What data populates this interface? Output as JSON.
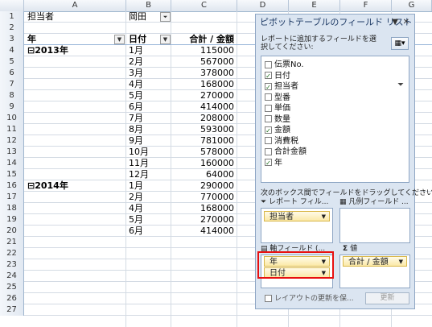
{
  "columns": [
    "A",
    "B",
    "C",
    "D",
    "E",
    "F",
    "G"
  ],
  "rows": [
    {
      "n": "1",
      "a": "担当者",
      "b": "岡田",
      "c": "",
      "bfilter": true
    },
    {
      "n": "2",
      "a": "",
      "b": "",
      "c": ""
    },
    {
      "n": "3",
      "a": "年",
      "b": "日付",
      "c": "合計 / 金額",
      "header": true
    },
    {
      "n": "4",
      "a": "⊟2013年",
      "b": "1月",
      "c": "115000",
      "bold": true
    },
    {
      "n": "5",
      "a": "",
      "b": "2月",
      "c": "567000"
    },
    {
      "n": "6",
      "a": "",
      "b": "3月",
      "c": "378000"
    },
    {
      "n": "7",
      "a": "",
      "b": "4月",
      "c": "168000"
    },
    {
      "n": "8",
      "a": "",
      "b": "5月",
      "c": "270000"
    },
    {
      "n": "9",
      "a": "",
      "b": "6月",
      "c": "414000"
    },
    {
      "n": "10",
      "a": "",
      "b": "7月",
      "c": "208000"
    },
    {
      "n": "11",
      "a": "",
      "b": "8月",
      "c": "593000"
    },
    {
      "n": "12",
      "a": "",
      "b": "9月",
      "c": "781000"
    },
    {
      "n": "13",
      "a": "",
      "b": "10月",
      "c": "578000"
    },
    {
      "n": "14",
      "a": "",
      "b": "11月",
      "c": "160000"
    },
    {
      "n": "15",
      "a": "",
      "b": "12月",
      "c": "64000"
    },
    {
      "n": "16",
      "a": "⊟2014年",
      "b": "1月",
      "c": "290000",
      "bold": true
    },
    {
      "n": "17",
      "a": "",
      "b": "2月",
      "c": "770000"
    },
    {
      "n": "18",
      "a": "",
      "b": "4月",
      "c": "168000"
    },
    {
      "n": "19",
      "a": "",
      "b": "5月",
      "c": "270000"
    },
    {
      "n": "20",
      "a": "",
      "b": "6月",
      "c": "414000"
    },
    {
      "n": "21",
      "a": "",
      "b": "",
      "c": ""
    },
    {
      "n": "22",
      "a": "",
      "b": "",
      "c": ""
    },
    {
      "n": "23",
      "a": "",
      "b": "",
      "c": ""
    },
    {
      "n": "24",
      "a": "",
      "b": "",
      "c": ""
    },
    {
      "n": "25",
      "a": "",
      "b": "",
      "c": ""
    },
    {
      "n": "26",
      "a": "",
      "b": "",
      "c": ""
    },
    {
      "n": "27",
      "a": "",
      "b": "",
      "c": ""
    }
  ],
  "panel": {
    "title": "ピボットテーブルのフィールド リスト",
    "instruction": "レポートに追加するフィールドを選択してください:",
    "fields": [
      {
        "label": "伝票No.",
        "checked": false
      },
      {
        "label": "日付",
        "checked": true
      },
      {
        "label": "担当者",
        "checked": true
      },
      {
        "label": "型番",
        "checked": false
      },
      {
        "label": "単価",
        "checked": false
      },
      {
        "label": "数量",
        "checked": false
      },
      {
        "label": "金額",
        "checked": true
      },
      {
        "label": "消費税",
        "checked": false
      },
      {
        "label": "合計金額",
        "checked": false
      },
      {
        "label": "年",
        "checked": true
      }
    ],
    "drag_hint": "次のボックス間でフィールドをドラッグしてください:",
    "report_filter_label": "レポート フィル...",
    "column_labels_label": "凡例フィールド ...",
    "row_labels_label": "軸フィールド (...",
    "values_label": "値",
    "filter_chips": [
      "担当者"
    ],
    "row_chips": [
      "年",
      "日付"
    ],
    "value_chips": [
      "合計 / 金額"
    ],
    "defer_label": "レイアウトの更新を保...",
    "update_button": "更新"
  }
}
